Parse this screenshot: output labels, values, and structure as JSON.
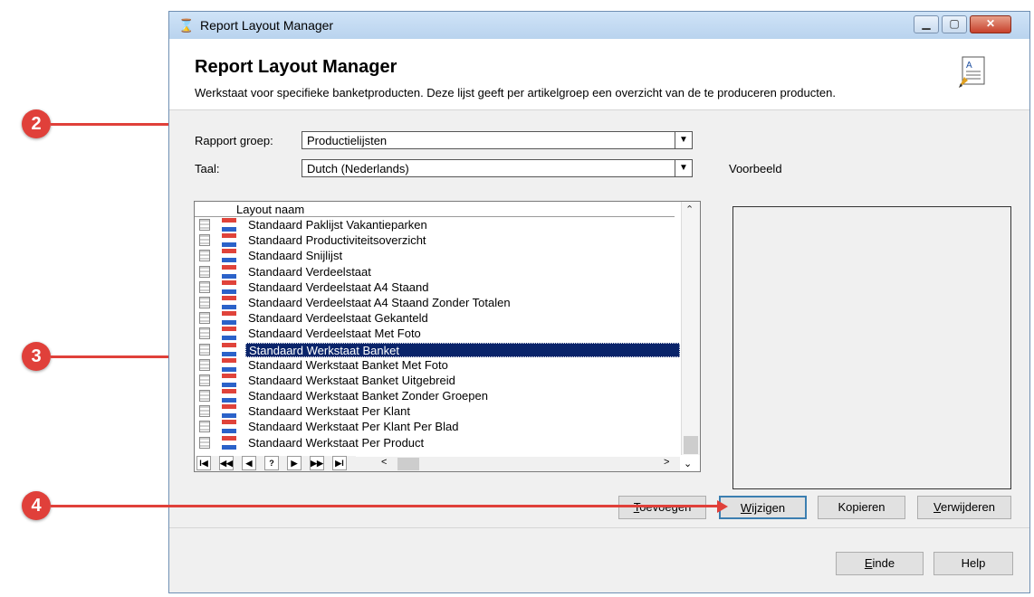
{
  "window": {
    "title": "Report Layout Manager",
    "heading": "Report Layout Manager",
    "description": "Werkstaat voor specifieke banketproducten. Deze lijst geeft per artikelgroep een overzicht van de te produceren producten."
  },
  "filters": {
    "rapport_groep_label": "Rapport groep:",
    "rapport_groep_value": "Productielijsten",
    "taal_label": "Taal:",
    "taal_value": "Dutch (Nederlands)",
    "voorbeeld_label": "Voorbeeld"
  },
  "grid": {
    "column_header": "Layout naam",
    "rows": [
      "Standaard Paklijst Vakantieparken",
      "Standaard Productiviteitsoverzicht",
      "Standaard Snijlijst",
      "Standaard Verdeelstaat",
      "Standaard Verdeelstaat A4 Staand",
      "Standaard Verdeelstaat A4 Staand Zonder Totalen",
      "Standaard Verdeelstaat Gekanteld",
      "Standaard Verdeelstaat Met Foto",
      "Standaard Werkstaat Banket",
      "Standaard Werkstaat Banket Met Foto",
      "Standaard Werkstaat Banket Uitgebreid",
      "Standaard Werkstaat Banket Zonder Groepen",
      "Standaard Werkstaat Per Klant",
      "Standaard Werkstaat Per Klant Per Blad",
      "Standaard Werkstaat Per Product"
    ],
    "selected_row": "Standaard Werkstaat Banket",
    "nav": [
      "I◀",
      "◀◀",
      "◀",
      "?",
      "▶",
      "▶▶",
      "▶I"
    ]
  },
  "buttons": {
    "toevoegen": {
      "first": "T",
      "rest": "oevoegen"
    },
    "wijzigen": {
      "first": "W",
      "rest": "ijzigen"
    },
    "kopieren": "Kopieren",
    "verwijderen": {
      "first": "V",
      "rest": "erwijderen"
    },
    "einde": {
      "first": "E",
      "rest": "inde"
    },
    "help": "Help"
  },
  "callouts": [
    "2",
    "3",
    "4"
  ],
  "colors": {
    "callout": "#e0403a",
    "selection": "#0a246a"
  }
}
